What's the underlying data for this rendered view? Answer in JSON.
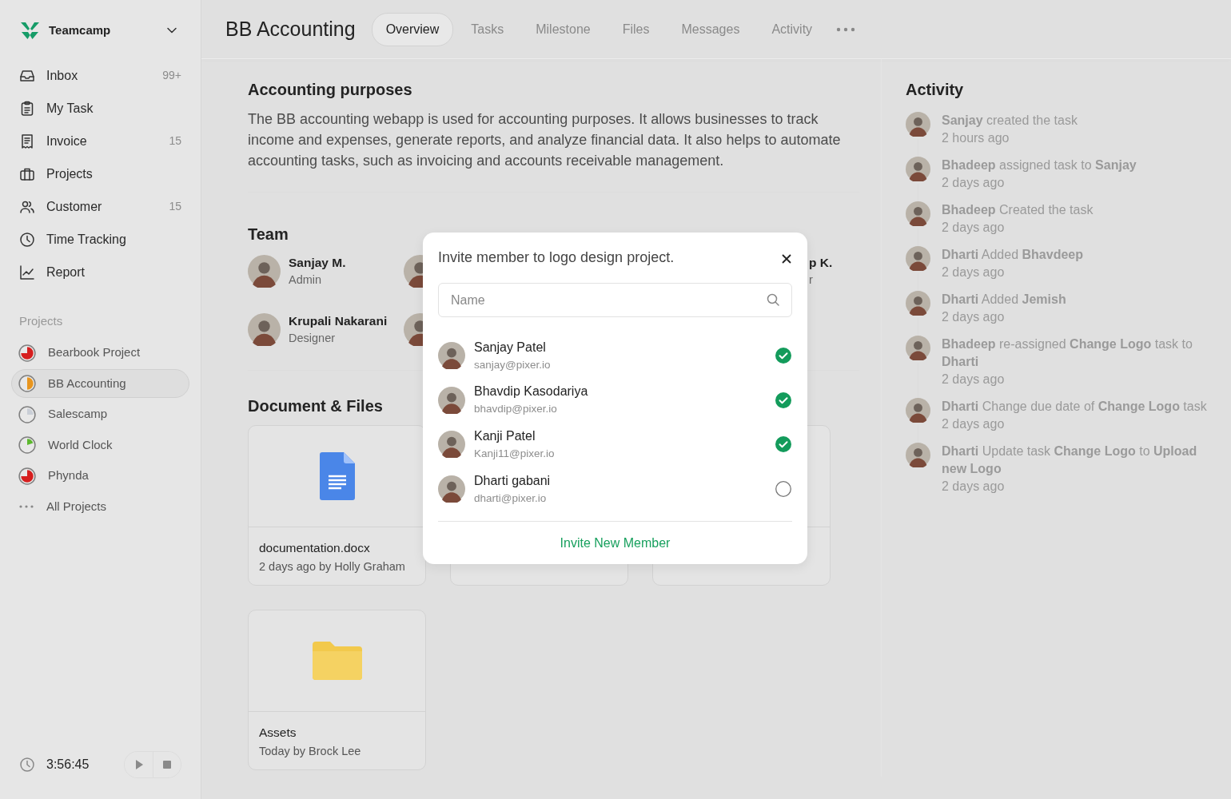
{
  "workspace": {
    "name": "Teamcamp"
  },
  "nav": [
    {
      "label": "Inbox",
      "count": "99+",
      "kind": "inbox"
    },
    {
      "label": "My Task",
      "kind": "task"
    },
    {
      "label": "Invoice",
      "count": "15",
      "kind": "invoice"
    },
    {
      "label": "Projects",
      "kind": "projects"
    },
    {
      "label": "Customer",
      "count": "15",
      "kind": "customer"
    },
    {
      "label": "Time Tracking",
      "kind": "clock"
    },
    {
      "label": "Report",
      "kind": "report"
    }
  ],
  "projects_heading": "Projects",
  "projects": [
    {
      "label": "Bearbook Project",
      "color": "#d61f1f",
      "kind": "three_quarters",
      "selected": false
    },
    {
      "label": "BB Accounting",
      "color": "#e8951e",
      "kind": "half",
      "selected": true
    },
    {
      "label": "Salescamp",
      "color": "#c9ced6",
      "kind": "quarter",
      "selected": false
    },
    {
      "label": "World Clock",
      "color": "#5cb82e",
      "kind": "fifth",
      "selected": false
    },
    {
      "label": "Phynda",
      "color": "#d61f1f",
      "kind": "three_quarters",
      "selected": false
    }
  ],
  "all_projects": "All Projects",
  "timer": {
    "time": "3:56:45"
  },
  "project_title": "BB Accounting",
  "tabs": [
    {
      "label": "Overview",
      "selected": true
    },
    {
      "label": "Tasks",
      "selected": false
    },
    {
      "label": "Milestone",
      "selected": false
    },
    {
      "label": "Files",
      "selected": false
    },
    {
      "label": "Messages",
      "selected": false
    },
    {
      "label": "Activity",
      "selected": false
    }
  ],
  "about": {
    "title": "Accounting purposes",
    "text": "The BB accounting webapp is used for accounting purposes. It allows businesses to track income and expenses, generate reports, and analyze financial data. It also helps to automate accounting tasks, such as invoicing and accounts receivable management."
  },
  "team": {
    "title": "Team",
    "members": [
      {
        "kind": "member",
        "name": "Sanjay M.",
        "role": "Admin"
      },
      {
        "kind": "covered"
      },
      {
        "kind": "cut",
        "name": "p K.",
        "role": "r"
      },
      {
        "kind": "member",
        "name": "Krupali Nakarani",
        "role": "Designer"
      },
      {
        "kind": "covered"
      }
    ]
  },
  "files": {
    "title": "Document & Files",
    "items": [
      {
        "kind": "doc",
        "name": "documentation.docx",
        "meta": "2 days ago by Holly Graham"
      },
      {
        "kind": "covered"
      },
      {
        "kind": "covered"
      },
      {
        "kind": "folder",
        "name": "Assets",
        "meta": "Today by Brock Lee"
      }
    ]
  },
  "activity": {
    "title": "Activity",
    "items": [
      {
        "text": "**Sanjay** created the task",
        "time": "2 hours ago"
      },
      {
        "text": "**Bhadeep** assigned task to **Sanjay**",
        "time": "2 days ago"
      },
      {
        "text": "**Bhadeep** Created the task",
        "time": "2 days ago"
      },
      {
        "text": "**Dharti** Added **Bhavdeep**",
        "time": "2 days ago"
      },
      {
        "text": "**Dharti** Added **Jemish**",
        "time": "2 days ago"
      },
      {
        "text": "**Bhadeep** re-assigned **Change Logo** task to **Dharti**",
        "time": "2 days ago"
      },
      {
        "text": "**Dharti** Change due date of **Change Logo** task",
        "time": "2 days ago"
      },
      {
        "text": "**Dharti** Update task **Change Logo** to **Upload new Logo**",
        "time": "2 days ago"
      }
    ]
  },
  "modal": {
    "title": "Invite member to logo design project.",
    "search": {
      "placeholder": "Name"
    },
    "members": [
      {
        "name": "Sanjay Patel",
        "email": "sanjay@pixer.io",
        "checked": true
      },
      {
        "name": "Bhavdip Kasodariya",
        "email": "bhavdip@pixer.io",
        "checked": true
      },
      {
        "name": "Kanji Patel",
        "email": "Kanji11@pixer.io",
        "checked": true
      },
      {
        "name": "Dharti gabani",
        "email": "dharti@pixer.io",
        "checked": false
      }
    ],
    "action": "Invite New Member"
  }
}
